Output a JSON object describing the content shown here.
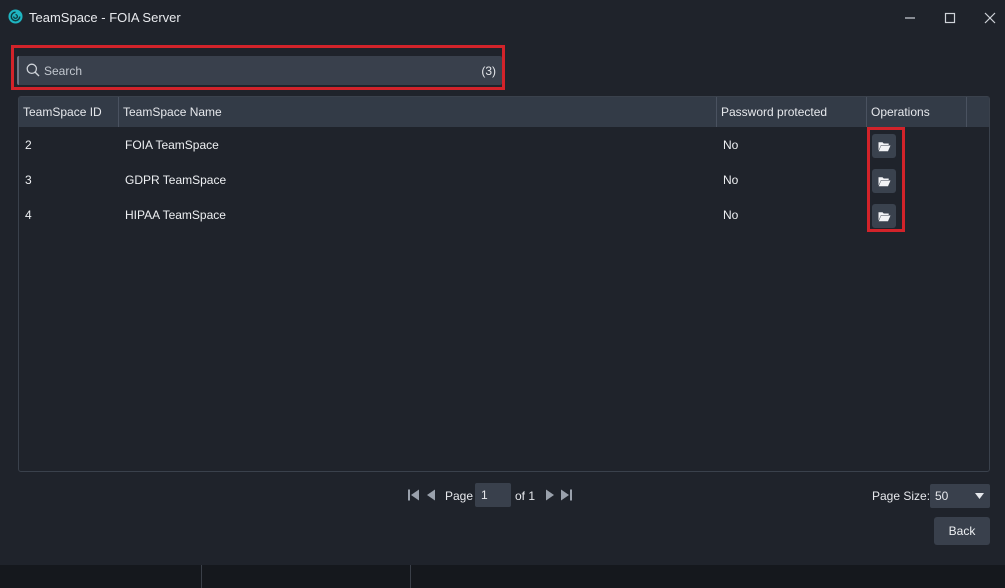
{
  "window": {
    "title": "TeamSpace - FOIA Server"
  },
  "search": {
    "placeholder": "Search",
    "value": "",
    "count": "(3)"
  },
  "table": {
    "columns": [
      "TeamSpace ID",
      "TeamSpace Name",
      "Password protected",
      "Operations"
    ],
    "rows": [
      {
        "id": "2",
        "name": "FOIA TeamSpace",
        "password_protected": "No"
      },
      {
        "id": "3",
        "name": "GDPR TeamSpace",
        "password_protected": "No"
      },
      {
        "id": "4",
        "name": "HIPAA TeamSpace",
        "password_protected": "No"
      }
    ]
  },
  "pager": {
    "page_label": "Page",
    "current_page": "1",
    "of_label": "of 1",
    "page_size_label": "Page Size:",
    "page_size": "50"
  },
  "footer": {
    "back_label": "Back"
  },
  "icons": {
    "app": "teamspace-logo-icon",
    "search": "search-icon",
    "open": "folder-open-icon",
    "first": "first-page-icon",
    "prev": "previous-page-icon",
    "next": "next-page-icon",
    "last": "last-page-icon"
  },
  "colors": {
    "background": "#1f232b",
    "panel": "#39404c",
    "header": "#333b47",
    "highlight": "#d2232a",
    "accent": "#1fb5c2"
  }
}
